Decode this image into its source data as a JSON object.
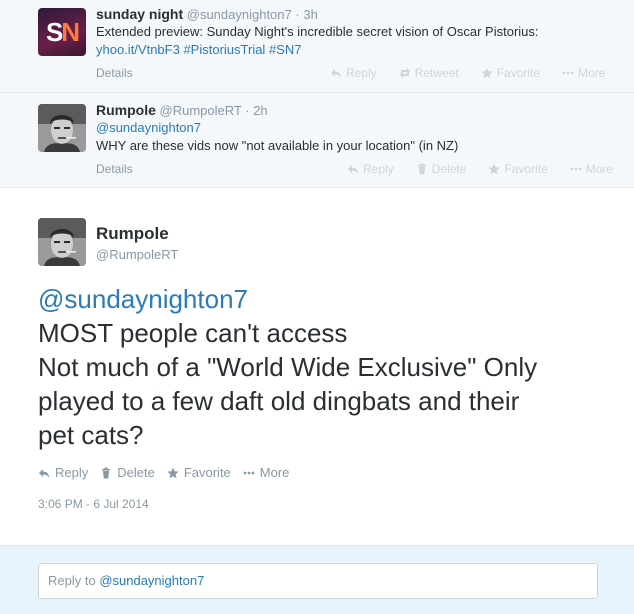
{
  "tweets": [
    {
      "name": "sunday night",
      "handle": "@sundaynighton7",
      "time": "3h",
      "text": "Extended preview: Sunday Night's incredible secret vision of Oscar Pistorius:",
      "link_line": [
        "yhoo.it/VtnbF3",
        "#PistoriusTrial",
        "#SN7"
      ],
      "details": "Details",
      "actions": [
        "Reply",
        "Retweet",
        "Favorite",
        "More"
      ]
    },
    {
      "name": "Rumpole",
      "handle": "@RumpoleRT",
      "time": "2h",
      "mention": "@sundaynighton7",
      "text": "WHY are these vids now \"not available in your location\"  (in NZ)",
      "details": "Details",
      "actions": [
        "Reply",
        "Delete",
        "Favorite",
        "More"
      ]
    }
  ],
  "main_tweet": {
    "name": "Rumpole",
    "handle": "@RumpoleRT",
    "mention": "@sundaynighton7",
    "lines": [
      "MOST people can't access",
      "Not much of a \"World Wide Exclusive\" Only",
      "played to a few daft old dingbats and their",
      "pet cats?"
    ],
    "actions": [
      "Reply",
      "Delete",
      "Favorite",
      "More"
    ],
    "timestamp": "3:06 PM - 6 Jul 2014"
  },
  "reply": {
    "prefix": "Reply to ",
    "mention": "@sundaynighton7"
  },
  "colors": {
    "link": "#2b7bb9",
    "muted": "#8899a6",
    "context_bg": "#f5f8fa",
    "reply_bg": "#e8f4fb"
  },
  "icons": [
    "reply-icon",
    "retweet-icon",
    "delete-icon",
    "favorite-icon",
    "more-icon"
  ]
}
